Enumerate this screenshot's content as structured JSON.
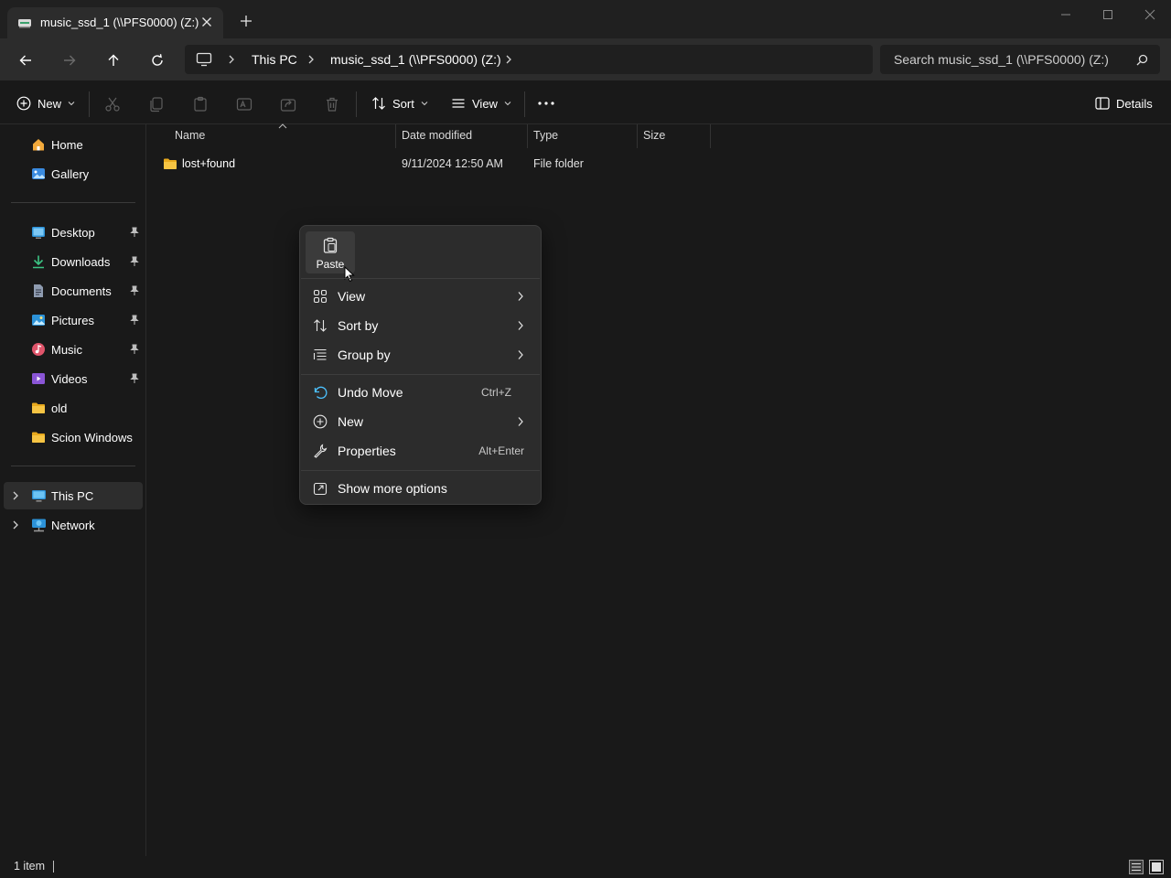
{
  "window": {
    "tab_title": "music_ssd_1 (\\\\PFS0000) (Z:)",
    "new_tab_symbol": "+"
  },
  "address_bar": {
    "crumbs": [
      "This PC",
      "music_ssd_1 (\\\\PFS0000) (Z:)"
    ],
    "search_placeholder": "Search music_ssd_1 (\\\\PFS0000) (Z:)"
  },
  "toolbar": {
    "new_label": "New",
    "sort_label": "Sort",
    "view_label": "View",
    "details_label": "Details"
  },
  "sidebar": {
    "top_items": [
      {
        "label": "Home",
        "icon": "home-icon"
      },
      {
        "label": "Gallery",
        "icon": "gallery-icon"
      }
    ],
    "pinned_items": [
      {
        "label": "Desktop",
        "icon": "desktop-folder-icon"
      },
      {
        "label": "Downloads",
        "icon": "downloads-icon"
      },
      {
        "label": "Documents",
        "icon": "documents-icon"
      },
      {
        "label": "Pictures",
        "icon": "pictures-icon"
      },
      {
        "label": "Music",
        "icon": "music-icon"
      },
      {
        "label": "Videos",
        "icon": "videos-icon"
      },
      {
        "label": "old",
        "icon": "folder-icon"
      },
      {
        "label": "Scion Windows",
        "icon": "folder-icon"
      }
    ],
    "bottom_items": [
      {
        "label": "This PC",
        "icon": "this-pc-icon"
      },
      {
        "label": "Network",
        "icon": "network-icon"
      }
    ]
  },
  "file_list": {
    "columns": [
      "Name",
      "Date modified",
      "Type",
      "Size"
    ],
    "rows": [
      {
        "name": "lost+found",
        "date_modified": "9/11/2024 12:50 AM",
        "type": "File folder",
        "size": ""
      }
    ]
  },
  "context_menu": {
    "paste_label": "Paste",
    "items": [
      {
        "label": "View",
        "shortcut": "",
        "submenu": true,
        "icon": "view-grid-icon"
      },
      {
        "label": "Sort by",
        "shortcut": "",
        "submenu": true,
        "icon": "sort-icon"
      },
      {
        "label": "Group by",
        "shortcut": "",
        "submenu": true,
        "icon": "group-by-icon"
      },
      {
        "label": "Undo Move",
        "shortcut": "Ctrl+Z",
        "submenu": false,
        "icon": "undo-icon"
      },
      {
        "label": "New",
        "shortcut": "",
        "submenu": true,
        "icon": "new-plus-icon"
      },
      {
        "label": "Properties",
        "shortcut": "Alt+Enter",
        "submenu": false,
        "icon": "wrench-icon"
      },
      {
        "label": "Show more options",
        "shortcut": "",
        "submenu": false,
        "icon": "open-external-icon"
      }
    ]
  },
  "status_bar": {
    "item_count": "1 item"
  },
  "colors": {
    "background": "#191919",
    "toolbar": "#2c2c2c",
    "folder_yellow": "#f6c443",
    "accent_blue": "#4cc2ff"
  }
}
